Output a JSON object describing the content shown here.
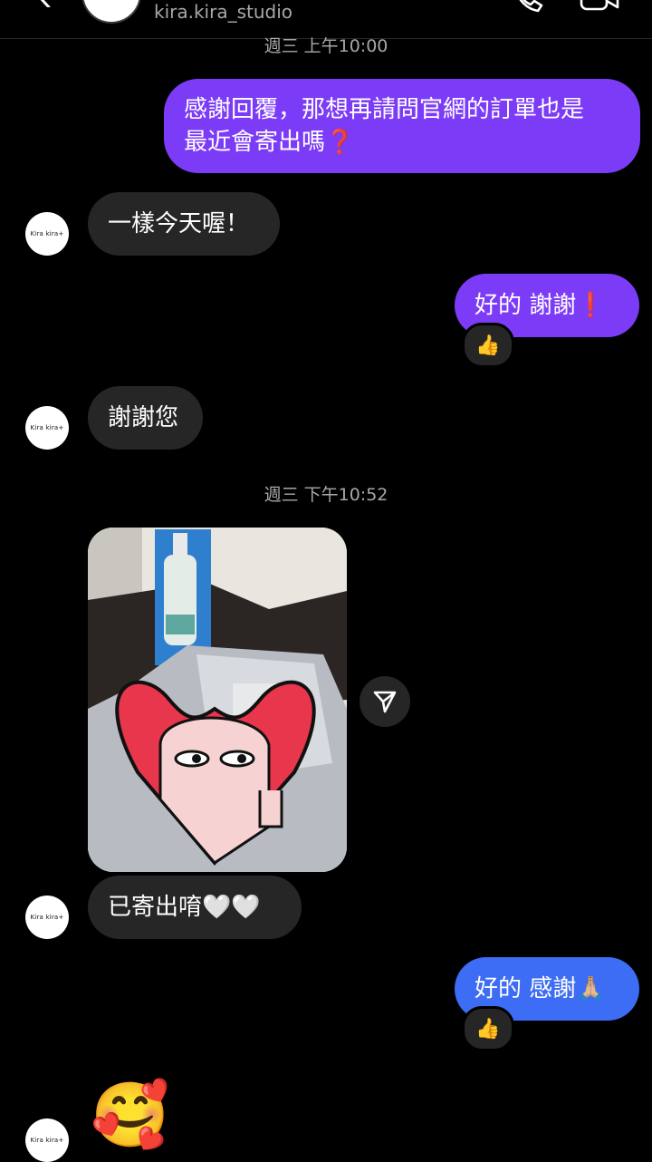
{
  "header": {
    "username": "kira.kira_studio"
  },
  "timestamps": [
    "週三 上午10:00",
    "週三 下午10:52"
  ],
  "contact": {
    "avatar_text": "Kira kira+"
  },
  "messages": {
    "m1": "感謝回覆，那想再請問官網的訂單也是\n最近會寄出嗎❓",
    "m2": "一樣今天喔！",
    "m3": "好的 謝謝❗️",
    "m4": "謝謝您",
    "m5": "已寄出唷🤍🤍",
    "m6": "好的 感謝🙏🏼",
    "m7": "🥰"
  },
  "reactions": {
    "r1": "👍",
    "r2": "👍"
  },
  "colors": {
    "outgoing_purple": "#7c3cf7",
    "outgoing_blue": "#3d6cf5",
    "incoming": "#262626",
    "background": "#000000"
  },
  "icons": [
    "back-arrow-icon",
    "phone-icon",
    "video-icon",
    "send-share-icon"
  ]
}
